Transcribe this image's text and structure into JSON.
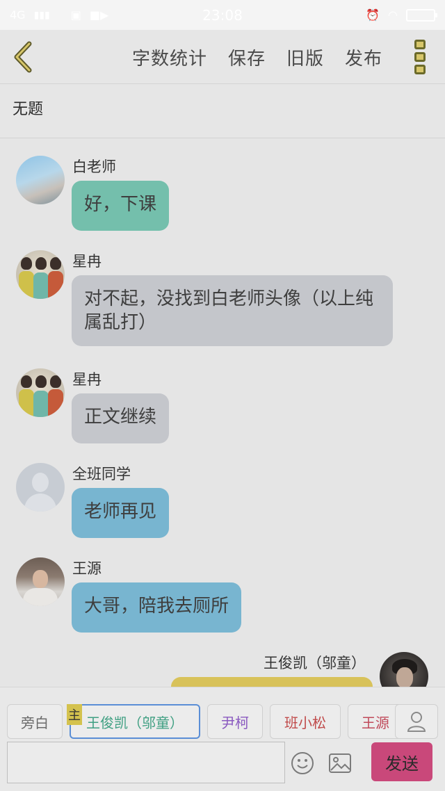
{
  "status_bar": {
    "network": "4G",
    "time": "23:08"
  },
  "header": {
    "actions": [
      "字数统计",
      "保存",
      "旧版",
      "发布"
    ]
  },
  "title": "无题",
  "messages": [
    {
      "sender": "白老师",
      "text": "好，下课",
      "bubble_color": "#74bfac"
    },
    {
      "sender": "星冉",
      "text": "对不起，没找到白老师头像（以上纯属乱打）",
      "bubble_color": "#c4c6cb"
    },
    {
      "sender": "星冉",
      "text": "正文继续",
      "bubble_color": "#c4c6cb"
    },
    {
      "sender": "全班同学",
      "text": "老师再见",
      "bubble_color": "#78b5d0"
    },
    {
      "sender": "王源",
      "text": "大哥，陪我去厕所",
      "bubble_color": "#78b5d0"
    },
    {
      "sender": "王俊凯（邬童）",
      "text": "",
      "bubble_color": "#d8c25a"
    }
  ],
  "roles": [
    {
      "label": "旁白",
      "color": "#6b6b6b"
    },
    {
      "label": "王俊凯（邬童）",
      "color": "#3f9f82",
      "selected": true,
      "badge": "主"
    },
    {
      "label": "尹柯",
      "color": "#8a5ac0"
    },
    {
      "label": "班小松",
      "color": "#c04a4a"
    },
    {
      "label": "王源",
      "color": "#c04a5a"
    }
  ],
  "input": {
    "placeholder": ""
  },
  "send_label": "发送",
  "colors": {
    "accent": "#c9487a",
    "gold": "#d7c66a"
  }
}
